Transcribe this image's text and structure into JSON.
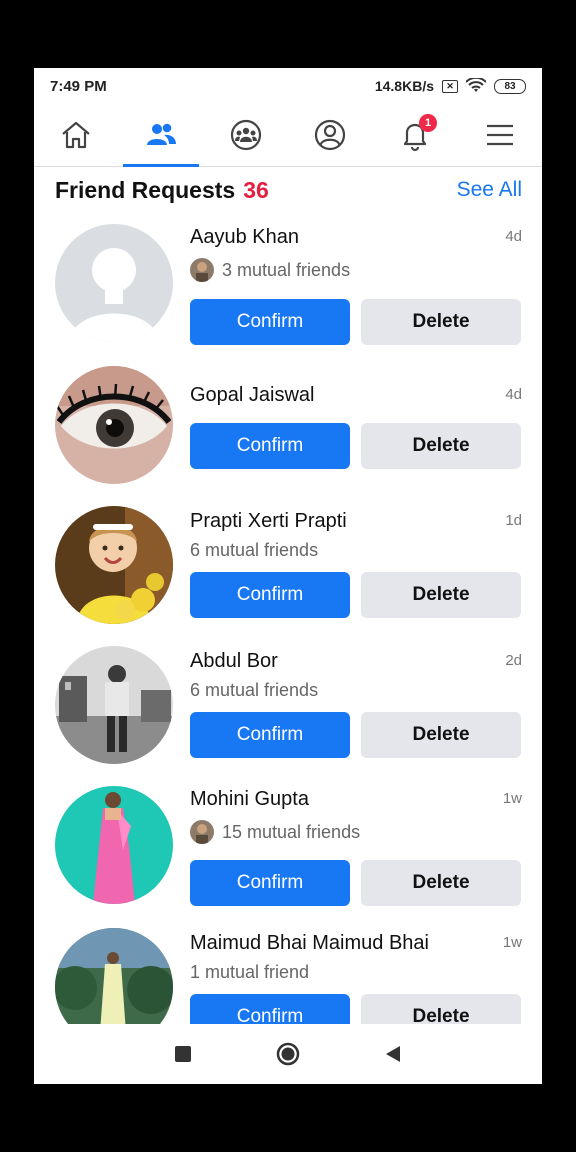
{
  "status_bar": {
    "time": "7:49 PM",
    "speed": "14.8KB/s",
    "battery": "83"
  },
  "nav": {
    "tabs": [
      {
        "name": "home",
        "icon": "home-icon"
      },
      {
        "name": "friends",
        "icon": "friends-icon",
        "active": true
      },
      {
        "name": "groups",
        "icon": "groups-icon"
      },
      {
        "name": "profile",
        "icon": "profile-icon"
      },
      {
        "name": "notifications",
        "icon": "bell-icon",
        "badge": "1"
      },
      {
        "name": "menu",
        "icon": "menu-icon"
      }
    ],
    "notification_badge": "1"
  },
  "header": {
    "title": "Friend Requests",
    "count": "36",
    "see_all": "See All"
  },
  "requests": [
    {
      "name": "Aayub Khan",
      "time": "4d",
      "mutual": "3 mutual friends",
      "confirm": "Confirm",
      "delete": "Delete"
    },
    {
      "name": "Gopal Jaiswal",
      "time": "4d",
      "confirm": "Confirm",
      "delete": "Delete"
    },
    {
      "name": "Prapti Xerti Prapti",
      "time": "1d",
      "mutual": "6 mutual friends",
      "confirm": "Confirm",
      "delete": "Delete"
    },
    {
      "name": "Abdul Bor",
      "time": "2d",
      "mutual": "6 mutual friends",
      "confirm": "Confirm",
      "delete": "Delete"
    },
    {
      "name": "Mohini Gupta",
      "time": "1w",
      "mutual": "15 mutual friends",
      "confirm": "Confirm",
      "delete": "Delete"
    },
    {
      "name": "Maimud Bhai Maimud Bhai",
      "time": "1w",
      "mutual": "1 mutual friend",
      "confirm": "Confirm",
      "delete": "Delete"
    }
  ],
  "colors": {
    "accent": "#1877f2",
    "count_red": "#e41e3f",
    "delete_bg": "#e4e6eb"
  }
}
